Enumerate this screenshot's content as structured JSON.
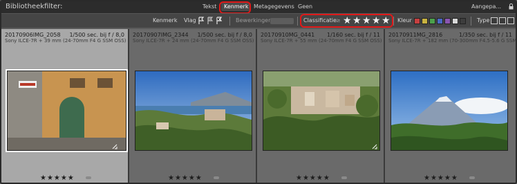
{
  "top_bar": {
    "title": "Bibliotheekfilter:",
    "tabs": [
      {
        "label": "Tekst",
        "active": false
      },
      {
        "label": "Kenmerk",
        "active": true
      },
      {
        "label": "Metagegevens",
        "active": false
      },
      {
        "label": "Geen",
        "active": false
      }
    ],
    "preset": "Aangepa..."
  },
  "filter_bar": {
    "kenmerk_label": "Kenmerk",
    "vlag_label": "Vlag",
    "bewerkingen_label": "Bewerkingen",
    "classificatie_label": "Classificatie",
    "classificatie_op": "≥",
    "stars": 5,
    "kleur_label": "Kleur",
    "type_label": "Type",
    "colors": [
      "#c74040",
      "#c9b340",
      "#4ca14c",
      "#4a68c4",
      "#8a55b0",
      "#d9d9d9",
      "#3d3d3d"
    ]
  },
  "photos": [
    {
      "name": "20170906IMG_2058",
      "exposure": "1/500 sec. bij f / 8,0",
      "lens": "Sony ILCE-7R + 39 mm (24-70mm F4 G SSM OSS)",
      "rating": "★★★★★",
      "selected": true
    },
    {
      "name": "20170907IMG_2344",
      "exposure": "1/500 sec. bij f / 8,0",
      "lens": "Sony ILCE-7R + 24 mm (24-70mm F4 G SSM OSS)",
      "rating": "★★★★★",
      "selected": false
    },
    {
      "name": "20170910MG_0441",
      "exposure": "1/160 sec. bij f / 11",
      "lens": "Sony ILCE-7R + 55 mm (24-70mm F4 G SSM OSS)",
      "rating": "★★★★★",
      "selected": false
    },
    {
      "name": "20170911MG_2816",
      "exposure": "1/350 sec. bij f / 11",
      "lens": "Sony ILCE-7R + 182 mm (70-300mm F4.5-5.6 G SSM OSS)",
      "rating": "★★★★★",
      "selected": false
    }
  ]
}
